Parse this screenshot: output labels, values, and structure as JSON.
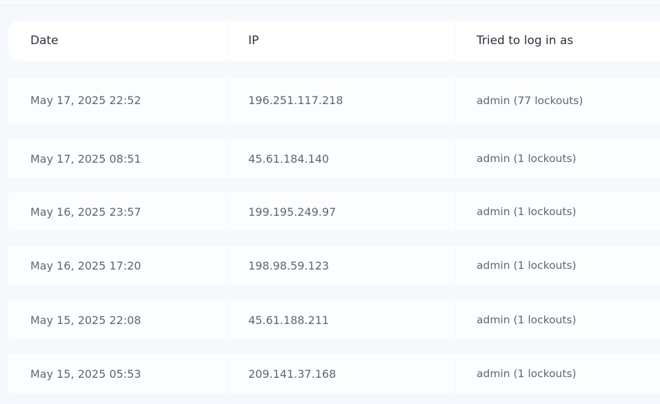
{
  "table": {
    "headers": {
      "date": "Date",
      "ip": "IP",
      "user": "Tried to log in as"
    },
    "rows": [
      {
        "date": "May 17, 2025 22:52",
        "ip": "196.251.117.218",
        "user": "admin (77 lockouts)"
      },
      {
        "date": "May 17, 2025 08:51",
        "ip": "45.61.184.140",
        "user": "admin (1 lockouts)"
      },
      {
        "date": "May 16, 2025 23:57",
        "ip": "199.195.249.97",
        "user": "admin (1 lockouts)"
      },
      {
        "date": "May 16, 2025 17:20",
        "ip": "198.98.59.123",
        "user": "admin (1 lockouts)"
      },
      {
        "date": "May 15, 2025 22:08",
        "ip": "45.61.188.211",
        "user": "admin (1 lockouts)"
      },
      {
        "date": "May 15, 2025 05:53",
        "ip": "209.141.37.168",
        "user": "admin (1 lockouts)"
      }
    ]
  }
}
